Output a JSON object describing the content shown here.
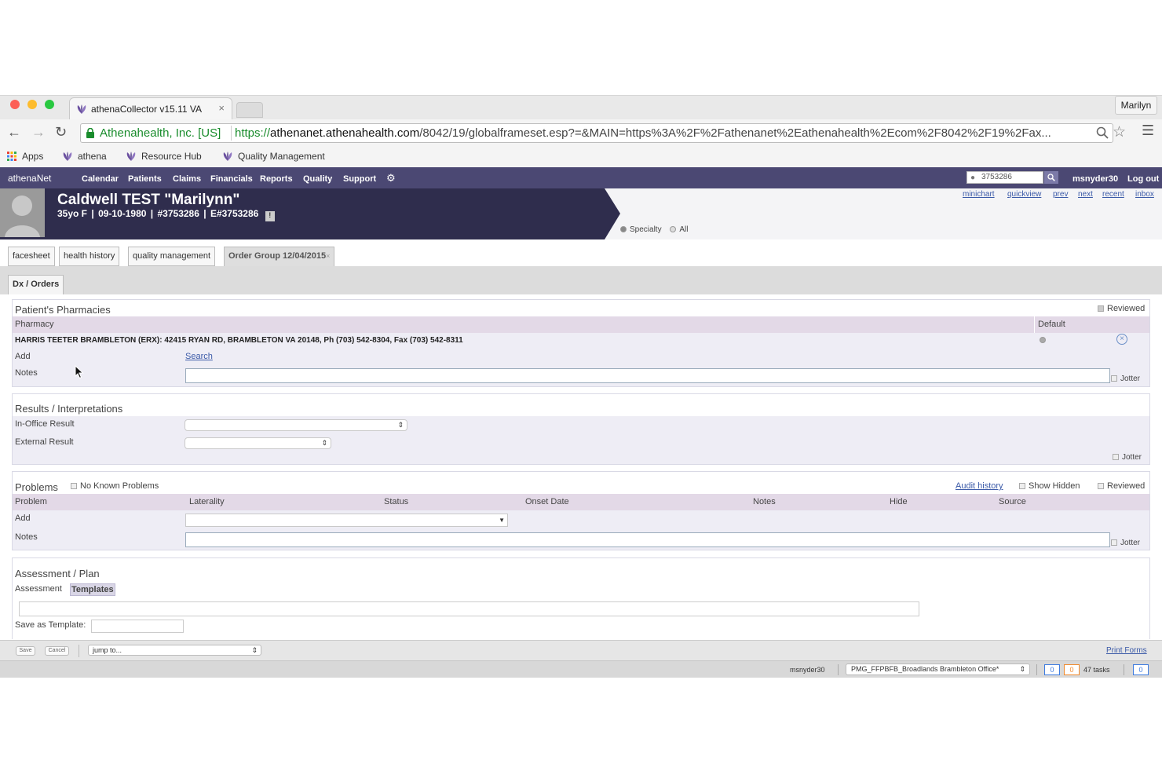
{
  "browser": {
    "tab_title": "athenaCollector v15.11 VA",
    "tab_close": "×",
    "profile_name": "Marilyn",
    "secure_label": "Athenahealth, Inc. [US]",
    "url_protocol": "https://",
    "url_host": "athenanet.athenahealth.com",
    "url_path": "/8042/19/globalframeset.esp?=&MAIN=https%3A%2F%2Fathenanet%2Eathenahealth%2Ecom%2F8042%2F19%2Fax...",
    "bookmarks": [
      "Apps",
      "athena",
      "Resource Hub",
      "Quality Management"
    ],
    "accent_green": "#198c2c"
  },
  "app_nav": {
    "logo": "athenaNet",
    "items": [
      "Calendar",
      "Patients",
      "Claims",
      "Financials",
      "Reports",
      "Quality",
      "Support"
    ],
    "search_value": "3753286",
    "username": "msnyder30",
    "logout": "Log out",
    "brand_color": "#4b4873"
  },
  "patient": {
    "name": "Caldwell TEST \"Marilynn\"",
    "age_sex": "35yo F",
    "dob": "09-10-1980",
    "id": "#3753286",
    "eid": "E#3753286",
    "links": [
      "minichart",
      "quickview",
      "prev",
      "next",
      "recent",
      "inbox"
    ],
    "scope_options": [
      "Specialty",
      "All"
    ]
  },
  "tabs": [
    "facesheet",
    "health history",
    "quality management",
    "Order Group 12/04/2015"
  ],
  "tab_close": "×",
  "subtab": "Dx / Orders",
  "pharmacies": {
    "title": "Patient's Pharmacies",
    "reviewed": "Reviewed",
    "col_pharmacy": "Pharmacy",
    "col_default": "Default",
    "pharmacy_line": "HARRIS TEETER BRAMBLETON (ERX): 42415 RYAN RD, BRAMBLETON VA 20148, Ph (703) 542-8304, Fax (703) 542-8311",
    "add_label": "Add",
    "search_link": "Search",
    "notes_label": "Notes",
    "jotter": "Jotter"
  },
  "results": {
    "title": "Results / Interpretations",
    "in_office": "In-Office Result",
    "external": "External Result",
    "jotter": "Jotter"
  },
  "problems": {
    "title": "Problems",
    "no_known": "No Known Problems",
    "audit_history": "Audit history",
    "show_hidden": "Show Hidden",
    "reviewed": "Reviewed",
    "columns": [
      "Problem",
      "Laterality",
      "Status",
      "Onset Date",
      "Notes",
      "Hide",
      "Source"
    ],
    "add_label": "Add",
    "notes_label": "Notes",
    "jotter": "Jotter"
  },
  "assessment": {
    "title": "Assessment / Plan",
    "assessment_label": "Assessment",
    "templates_label": "Templates",
    "save_template_label": "Save as Template:"
  },
  "actions": {
    "save": "Save",
    "cancel": "Cancel",
    "jump_to": "jump to...",
    "print_forms": "Print Forms"
  },
  "status": {
    "user": "msnyder30",
    "department": "PMG_FFPBFB_Broadlands Brambleton Office*",
    "counter_blue": "0",
    "counter_orange": "0",
    "tasks": "47 tasks",
    "counter_right": "0"
  }
}
